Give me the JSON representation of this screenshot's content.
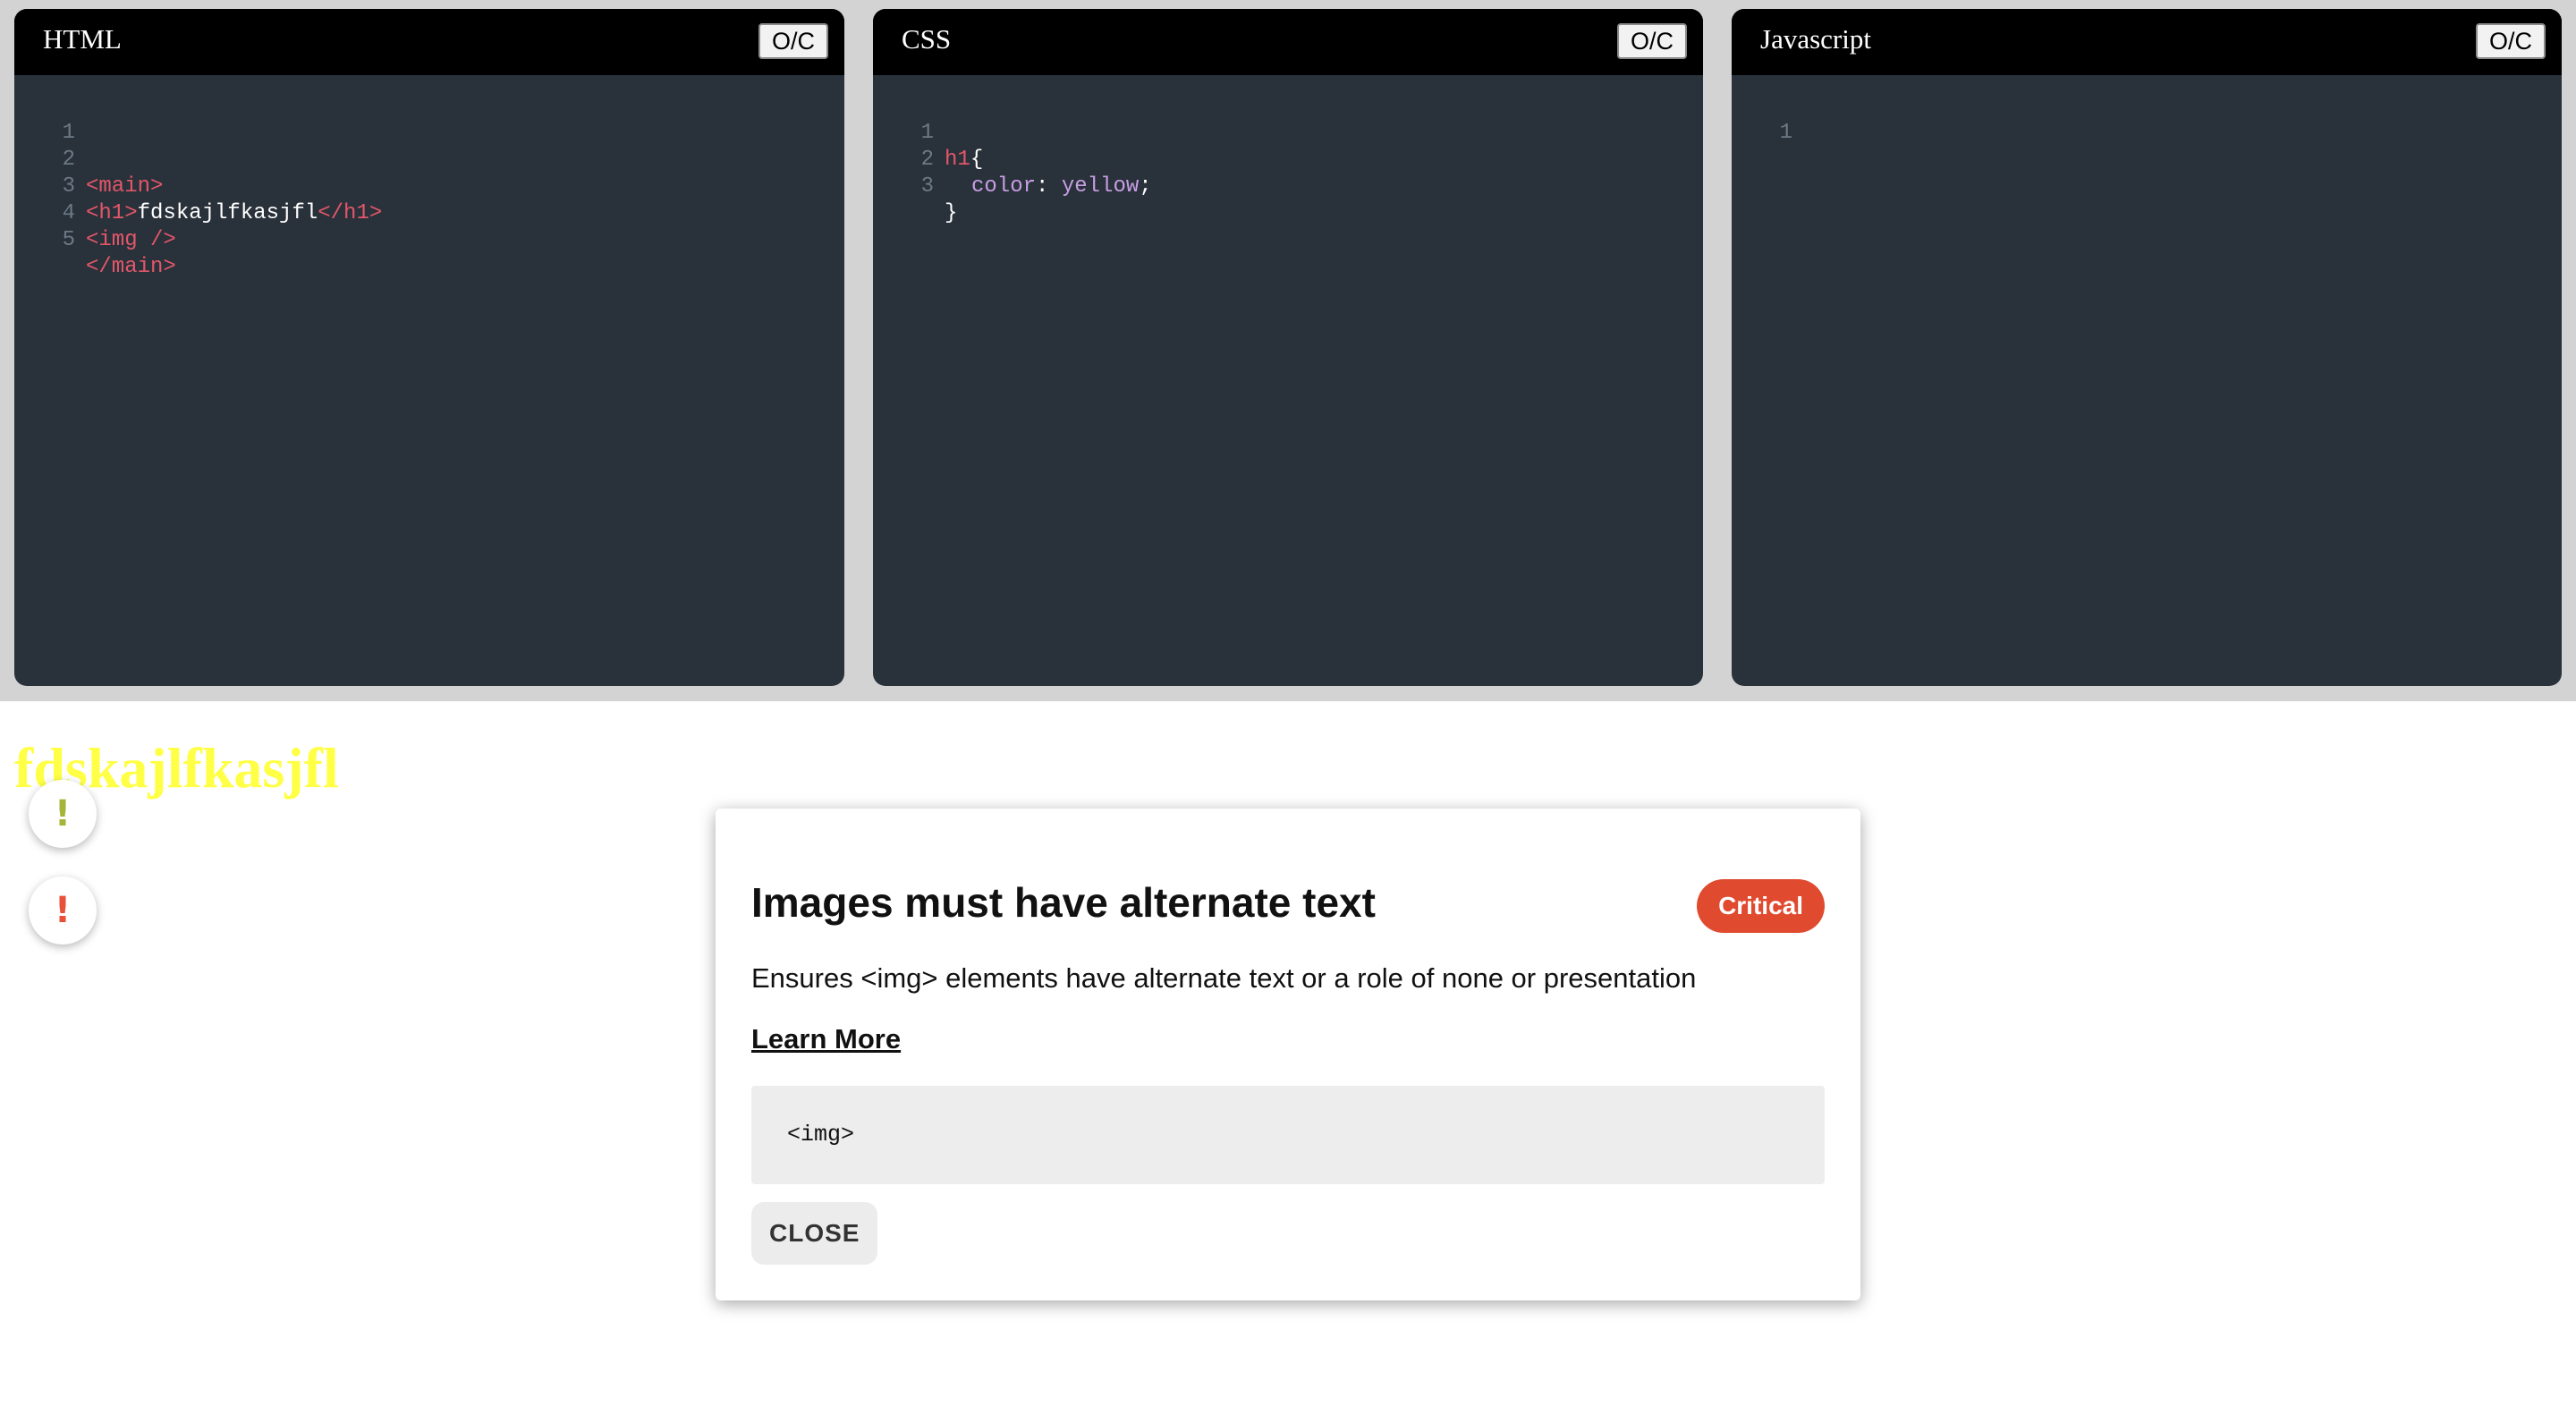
{
  "editors": {
    "button_label": "O/C",
    "html": {
      "title": "HTML",
      "lines": [
        "1",
        "2",
        "3",
        "4",
        "5"
      ],
      "code": {
        "l2": "<main>",
        "l3_open": "<h1>",
        "l3_text": "fdskajlfkasjfl",
        "l3_close": "</h1>",
        "l4": "<img />",
        "l5": "</main>"
      }
    },
    "css": {
      "title": "CSS",
      "lines": [
        "1",
        "2",
        "3"
      ],
      "code": {
        "selector": "h1",
        "open_brace": "{",
        "property": "color",
        "colon": ": ",
        "value": "yellow",
        "semicolon": ";",
        "close_brace": "}"
      }
    },
    "js": {
      "title": "Javascript",
      "lines": [
        "1"
      ]
    }
  },
  "preview": {
    "heading": "fdskajlfkasjfl",
    "warning_marks": [
      "!",
      "!"
    ]
  },
  "modal": {
    "title": "Images must have alternate text",
    "impact": "Critical",
    "description": "Ensures <img> elements have alternate text or a role of none or presentation",
    "learn_more": "Learn More",
    "snippet": "<img>",
    "close_label": "CLOSE"
  },
  "colors": {
    "editor_bg": "#29313a",
    "header_bg": "#000000",
    "tag": "#e3576a",
    "css_value": "#c89ee4",
    "preview_heading": "#ffff00",
    "minor_warning": "#a6b43a",
    "critical": "#e04a2f"
  }
}
